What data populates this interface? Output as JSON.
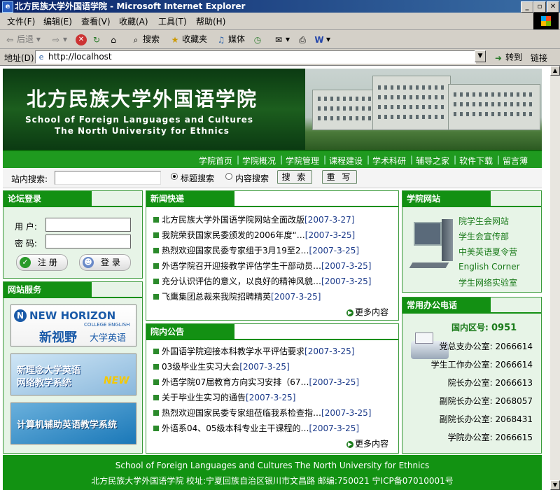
{
  "window": {
    "title": "北方民族大学外国语学院 - Microsoft Internet Explorer",
    "buttons": [
      "_",
      "▫",
      "✕"
    ]
  },
  "menubar": {
    "items": [
      "文件(F)",
      "编辑(E)",
      "查看(V)",
      "收藏(A)",
      "工具(T)",
      "帮助(H)"
    ]
  },
  "toolbar": {
    "back": "后退",
    "search": "搜索",
    "favorites": "收藏夹",
    "media": "媒体"
  },
  "addressbar": {
    "label": "地址(D)",
    "url": "http://localhost",
    "go": "转到",
    "links": "链接"
  },
  "banner": {
    "title_cn": "北方民族大学外国语学院",
    "title_en_1": "School of Foreign Languages and Cultures",
    "title_en_2": "The North University for Ethnics"
  },
  "nav": {
    "items": [
      "学院首页",
      "学院概况",
      "学院管理",
      "课程建设",
      "学术科研",
      "辅导之家",
      "软件下载",
      "留言薄"
    ]
  },
  "search": {
    "label": "站内搜索:",
    "option_title": "标题搜索",
    "option_content": "内容搜索",
    "search_button": "搜 索",
    "reset_button": "重 写"
  },
  "login": {
    "heading": "论坛登录",
    "user_label": "用 户:",
    "password_label": "密 码:",
    "register_button": "注 册",
    "login_button": "登 录"
  },
  "services": {
    "heading": "网站服务",
    "nh_title": "NEW HORIZON",
    "nh_sub": "COLLEGE ENGLISH",
    "nh_cn": "新视野",
    "nh_cn2": "大学英语",
    "np_line1": "新理念大学英语",
    "np_line2": "网络教学系统",
    "np_badge": "NEW",
    "cai": "计算机辅助英语教学系统"
  },
  "news": {
    "heading": "新闻快递",
    "items": [
      {
        "title": "北方民族大学外国语学院网站全面改版",
        "date": "[2007-3-27]"
      },
      {
        "title": "我院荣获国家民委颁发的2006年度“…",
        "date": "[2007-3-25]"
      },
      {
        "title": "热烈欢迎国家民委专家组于3月19至2…",
        "date": "[2007-3-25]"
      },
      {
        "title": "外语学院召开迎接教学评估学生干部动员…",
        "date": "[2007-3-25]"
      },
      {
        "title": "充分认识评估的意义，以良好的精神风貌…",
        "date": "[2007-3-25]"
      },
      {
        "title": "飞鹰集团总裁来我院招聘精英",
        "date": "[2007-3-25]"
      }
    ],
    "more": "更多内容"
  },
  "notices": {
    "heading": "院内公告",
    "items": [
      {
        "title": "外国语学院迎接本科教学水平评估要求",
        "date": "[2007-3-25]"
      },
      {
        "title": "03级毕业生实习大会",
        "date": "[2007-3-25]"
      },
      {
        "title": "外语学院07届教育方向实习安排（67…",
        "date": "[2007-3-25]"
      },
      {
        "title": "关于毕业生实习的通告",
        "date": "[2007-3-25]"
      },
      {
        "title": "热烈欢迎国家民委专家组莅临我系检查指…",
        "date": "[2007-3-25]"
      },
      {
        "title": "外语系04、05级本科专业主干课程的…",
        "date": "[2007-3-25]"
      }
    ],
    "more": "更多内容"
  },
  "sites": {
    "heading": "学院网站",
    "items": [
      "院学生会网站",
      "学生会宣传部",
      "中美英语夏令营",
      "English Corner",
      "学生网络实验室"
    ]
  },
  "phones": {
    "heading": "常用办公电话",
    "area_label": "国内区号:",
    "area_code": "0951",
    "items": [
      {
        "office": "党总支办公室:",
        "number": "2066614"
      },
      {
        "office": "学生工作办公室:",
        "number": "2066614"
      },
      {
        "office": "院长办公室:",
        "number": "2066613"
      },
      {
        "office": "副院长办公室:",
        "number": "2068057"
      },
      {
        "office": "副院长办公室:",
        "number": "2068431"
      },
      {
        "office": "学院办公室:",
        "number": "2066615"
      }
    ]
  },
  "footer": {
    "line1": "School of Foreign Languages and Cultures The North University for Ethnics",
    "line2": "北方民族大学外国语学院 校址:宁夏回族自治区银川市文昌路 邮编:750021 宁ICP备07010001号"
  },
  "colors": {
    "brand_green": "#139013",
    "dark_green": "#0b3a12",
    "link_green": "#1a7a1a",
    "date_blue": "#1b3a8a"
  }
}
